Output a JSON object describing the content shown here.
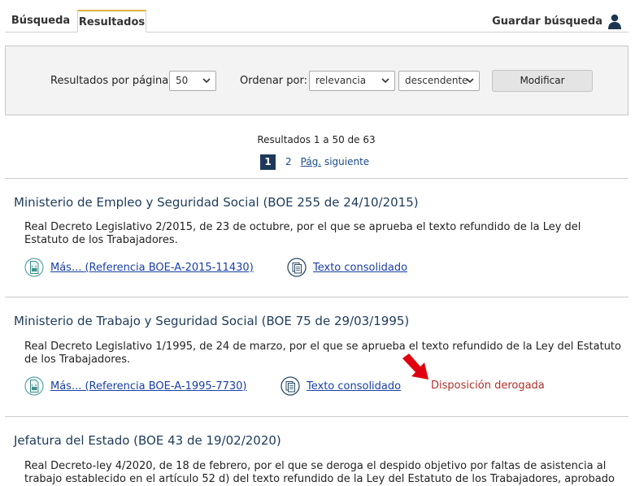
{
  "tabs": {
    "search": "Búsqueda",
    "results": "Resultados"
  },
  "save_search": "Guardar búsqueda",
  "options": {
    "per_page_label": "Resultados por página:",
    "per_page_value": "50",
    "order_label": "Ordenar por:",
    "order_value": "relevancia",
    "direction_value": "descendente",
    "modify_button": "Modificar"
  },
  "results_summary": "Resultados 1 a 50 de 63",
  "pagination": {
    "current": "1",
    "page2": "2",
    "next_abbr": "Pág.",
    "next_rest": " siguiente"
  },
  "results": [
    {
      "title": "Ministerio de Empleo y Seguridad Social (BOE 255 de 24/10/2015)",
      "description": "Real Decreto Legislativo 2/2015, de 23 de octubre, por el que se aprueba el texto refundido de la Ley del Estatuto de los Trabajadores.",
      "more_link": "Más... (Referencia BOE-A-2015-11430)",
      "consolidated_link": "Texto consolidado"
    },
    {
      "title": "Ministerio de Trabajo y Seguridad Social (BOE 75 de 29/03/1995)",
      "description": "Real Decreto Legislativo 1/1995, de 24 de marzo, por el que se aprueba el texto refundido de la Ley del Estatuto de los Trabajadores.",
      "more_link": "Más... (Referencia BOE-A-1995-7730)",
      "consolidated_link": "Texto consolidado",
      "status": "Disposición derogada"
    },
    {
      "title": "Jefatura del Estado (BOE 43 de 19/02/2020)",
      "description": "Real Decreto-ley 4/2020, de 18 de febrero, por el que se deroga el despido objetivo por faltas de asistencia al trabajo establecido en el artículo 52 d) del texto refundido de la Ley del Estatuto de los Trabajadores, aprobado"
    }
  ],
  "colors": {
    "accent_tab": "#e0b23c",
    "title": "#1e3b5a",
    "link": "#1a40a8",
    "derogada": "#b0302a",
    "arrow": "#e0000f"
  }
}
